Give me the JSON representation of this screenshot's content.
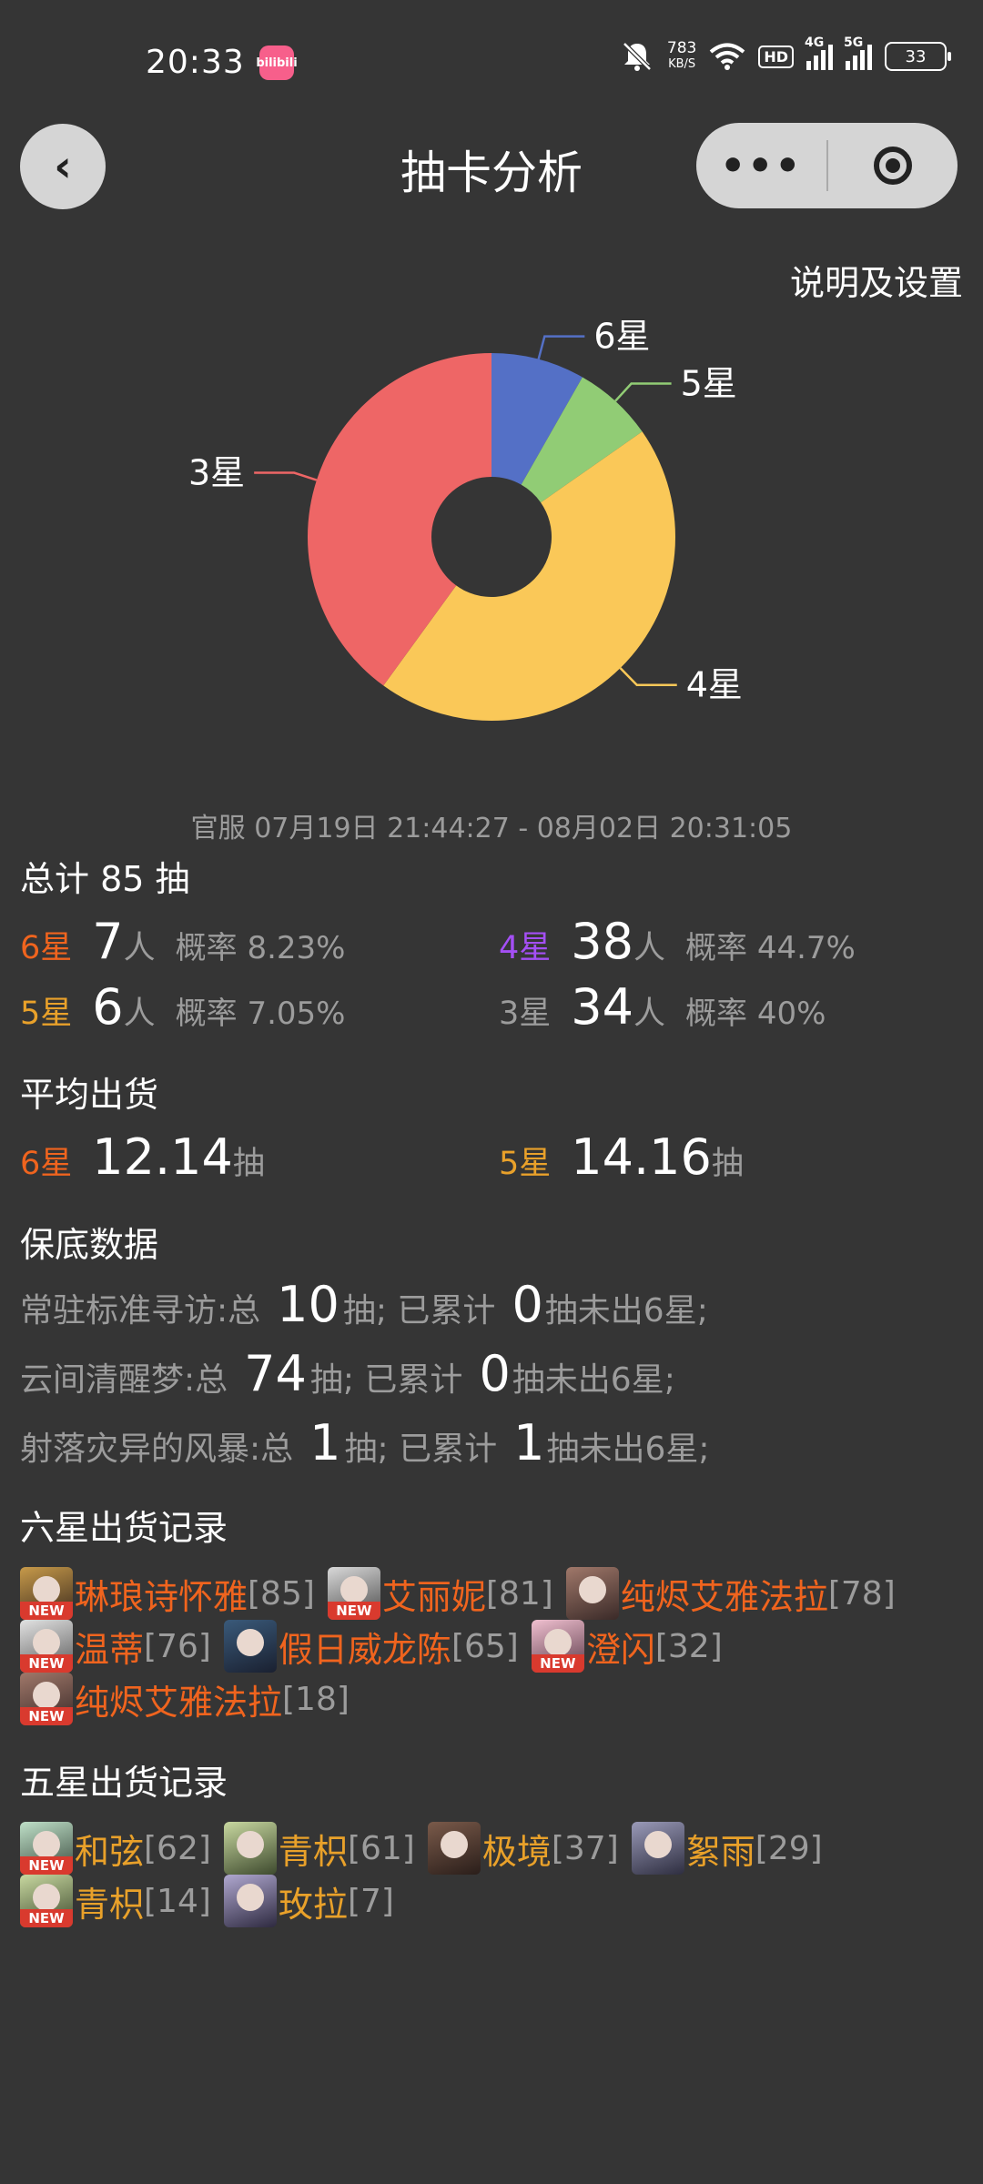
{
  "status_bar": {
    "time": "20:33",
    "app_badge": "bilibili",
    "net_speed_value": "783",
    "net_speed_unit": "KB/S",
    "hd_label": "HD",
    "sig1_label": "4G",
    "sig2_label": "5G",
    "battery": "33"
  },
  "nav": {
    "back_icon": "‹",
    "title": "抽卡分析",
    "more_icon": "•••"
  },
  "settings_link": "说明及设置",
  "chart_data": {
    "type": "pie",
    "donut": true,
    "categories": [
      "6星",
      "5星",
      "4星",
      "3星"
    ],
    "values": [
      7,
      6,
      38,
      34
    ],
    "colors": [
      "#5470c6",
      "#91cc75",
      "#fac858",
      "#ee6666"
    ],
    "legend": "none"
  },
  "server_line": "官服  07月19日 21:44:27  -  08月02日 20:31:05",
  "summary": {
    "title": "总计 85 抽",
    "rows": [
      {
        "star": "6星",
        "count": "7",
        "unit": "人",
        "rate": "概率 8.23%"
      },
      {
        "star": "4星",
        "count": "38",
        "unit": "人",
        "rate": "概率 44.7%"
      },
      {
        "star": "5星",
        "count": "6",
        "unit": "人",
        "rate": "概率 7.05%"
      },
      {
        "star": "3星",
        "count": "34",
        "unit": "人",
        "rate": "概率 40%"
      }
    ]
  },
  "average": {
    "title": "平均出货",
    "rows": [
      {
        "star": "6星",
        "value": "12.14",
        "unit": "抽"
      },
      {
        "star": "5星",
        "value": "14.16",
        "unit": "抽"
      }
    ]
  },
  "pity": {
    "title": "保底数据",
    "rows": [
      {
        "pool": "常驻标准寻访:总",
        "total": "10",
        "mid": "抽; 已累计",
        "since": "0",
        "tail": "抽未出6星;"
      },
      {
        "pool": "云间清醒梦:总",
        "total": "74",
        "mid": "抽; 已累计",
        "since": "0",
        "tail": "抽未出6星;"
      },
      {
        "pool": "射落灾异的风暴:总",
        "total": "1",
        "mid": "抽; 已累计",
        "since": "1",
        "tail": "抽未出6星;"
      }
    ]
  },
  "six_star_records": {
    "title": "六星出货记录",
    "new_tag": "NEW",
    "items": [
      {
        "name": "琳琅诗怀雅",
        "count": "[85]",
        "is_new": true
      },
      {
        "name": "艾丽妮",
        "count": "[81]",
        "is_new": true
      },
      {
        "name": "纯烬艾雅法拉",
        "count": "[78]",
        "is_new": false
      },
      {
        "name": "温蒂",
        "count": "[76]",
        "is_new": true
      },
      {
        "name": "假日威龙陈",
        "count": "[65]",
        "is_new": false
      },
      {
        "name": "澄闪",
        "count": "[32]",
        "is_new": true
      },
      {
        "name": "纯烬艾雅法拉",
        "count": "[18]",
        "is_new": true
      }
    ]
  },
  "five_star_records": {
    "title": "五星出货记录",
    "new_tag": "NEW",
    "items": [
      {
        "name": "和弦",
        "count": "[62]",
        "is_new": true
      },
      {
        "name": "青枳",
        "count": "[61]",
        "is_new": false
      },
      {
        "name": "极境",
        "count": "[37]",
        "is_new": false
      },
      {
        "name": "絮雨",
        "count": "[29]",
        "is_new": false
      },
      {
        "name": "青枳",
        "count": "[14]",
        "is_new": true
      },
      {
        "name": "玫拉",
        "count": "[7]",
        "is_new": false
      }
    ]
  }
}
